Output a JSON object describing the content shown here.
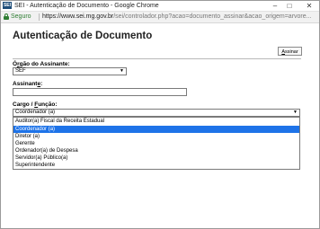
{
  "window": {
    "logo_text": "SEI",
    "title": "SEI - Autenticação de Documento - Google Chrome",
    "minimize_symbol": "–",
    "maximize_symbol": "□",
    "close_symbol": "✕"
  },
  "addressbar": {
    "secure_label": "Seguro",
    "url_host": "https://www.sei.mg.gov.br",
    "url_path": "/sei/controlador.php?acao=documento_assinar&acao_origem=arvore..."
  },
  "page": {
    "title": "Autenticação de Documento",
    "assinar_button": {
      "accesskey": "A",
      "rest": "ssinar"
    }
  },
  "form": {
    "orgao": {
      "label_prefix": "Ó",
      "label_accesskey": "r",
      "label_rest": "gão do Assinante:",
      "value": "SEF"
    },
    "assinante": {
      "label_prefix": "Assinant",
      "label_accesskey": "e",
      "label_rest": ":",
      "value": ""
    },
    "cargo": {
      "label_prefix": "Cargo / ",
      "label_accesskey": "F",
      "label_rest": "unção:",
      "value": "Coordenador (a)",
      "options": [
        "Auditor(a) Fiscal da Receita Estadual",
        "Coordenador (a)",
        "Diretor (a)",
        "Gerente",
        "Ordenador(a) de Despesa",
        "Servidor(a) Público(a)",
        "Superintendente"
      ],
      "selected_index": 1
    }
  },
  "colors": {
    "secure_green": "#2e7d32",
    "highlight_blue": "#1e73e8"
  },
  "icons": {
    "lock": "lock-icon",
    "dropdown": "chevron-down-icon"
  }
}
